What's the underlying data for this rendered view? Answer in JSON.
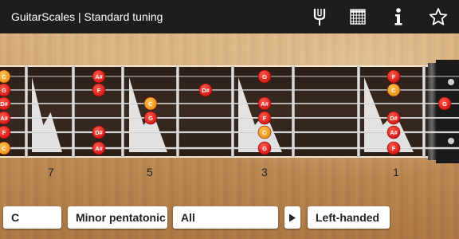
{
  "app": {
    "title": "GuitarScales | Standard tuning"
  },
  "toolbar": {
    "icons": [
      "tuning-fork-icon",
      "chord-grid-icon",
      "info-icon",
      "star-icon"
    ]
  },
  "fret_numbers": [
    {
      "label": "7",
      "fret": 7
    },
    {
      "label": "5",
      "fret": 5
    },
    {
      "label": "3",
      "fret": 3
    },
    {
      "label": "1",
      "fret": 1
    }
  ],
  "notes": [
    {
      "name": "C",
      "string": 1,
      "fret": 8,
      "root": true
    },
    {
      "name": "G",
      "string": 2,
      "fret": 8,
      "root": false
    },
    {
      "name": "D#",
      "string": 3,
      "fret": 8,
      "root": false
    },
    {
      "name": "A#",
      "string": 4,
      "fret": 8,
      "root": false
    },
    {
      "name": "F",
      "string": 5,
      "fret": 8,
      "root": false
    },
    {
      "name": "C",
      "string": 6,
      "fret": 8,
      "root": true
    },
    {
      "name": "A#",
      "string": 1,
      "fret": 6,
      "root": false
    },
    {
      "name": "F",
      "string": 2,
      "fret": 6,
      "root": false
    },
    {
      "name": "D#",
      "string": 5,
      "fret": 6,
      "root": false
    },
    {
      "name": "A#",
      "string": 6,
      "fret": 6,
      "root": false
    },
    {
      "name": "C",
      "string": 3,
      "fret": 5,
      "root": true
    },
    {
      "name": "G",
      "string": 4,
      "fret": 5,
      "root": false
    },
    {
      "name": "D#",
      "string": 2,
      "fret": 4,
      "root": false
    },
    {
      "name": "G",
      "string": 1,
      "fret": 3,
      "root": false
    },
    {
      "name": "A#",
      "string": 3,
      "fret": 3,
      "root": false
    },
    {
      "name": "F",
      "string": 4,
      "fret": 3,
      "root": false
    },
    {
      "name": "C",
      "string": 5,
      "fret": 3,
      "root": true
    },
    {
      "name": "G",
      "string": 6,
      "fret": 3,
      "root": false
    },
    {
      "name": "F",
      "string": 1,
      "fret": 1,
      "root": false
    },
    {
      "name": "C",
      "string": 2,
      "fret": 1,
      "root": true
    },
    {
      "name": "D#",
      "string": 4,
      "fret": 1,
      "root": false
    },
    {
      "name": "A#",
      "string": 5,
      "fret": 1,
      "root": false
    },
    {
      "name": "F",
      "string": 6,
      "fret": 1,
      "root": false
    },
    {
      "name": "G",
      "string": 3,
      "fret": 0,
      "root": false
    }
  ],
  "colors": {
    "note": "#e51616",
    "root_note": "#f0a020",
    "fretboard": "#34261e"
  },
  "controls": {
    "key": "C",
    "scale": "Minor pentatonic",
    "position": "All",
    "play_icon": "play-icon",
    "handedness": "Left-handed"
  }
}
